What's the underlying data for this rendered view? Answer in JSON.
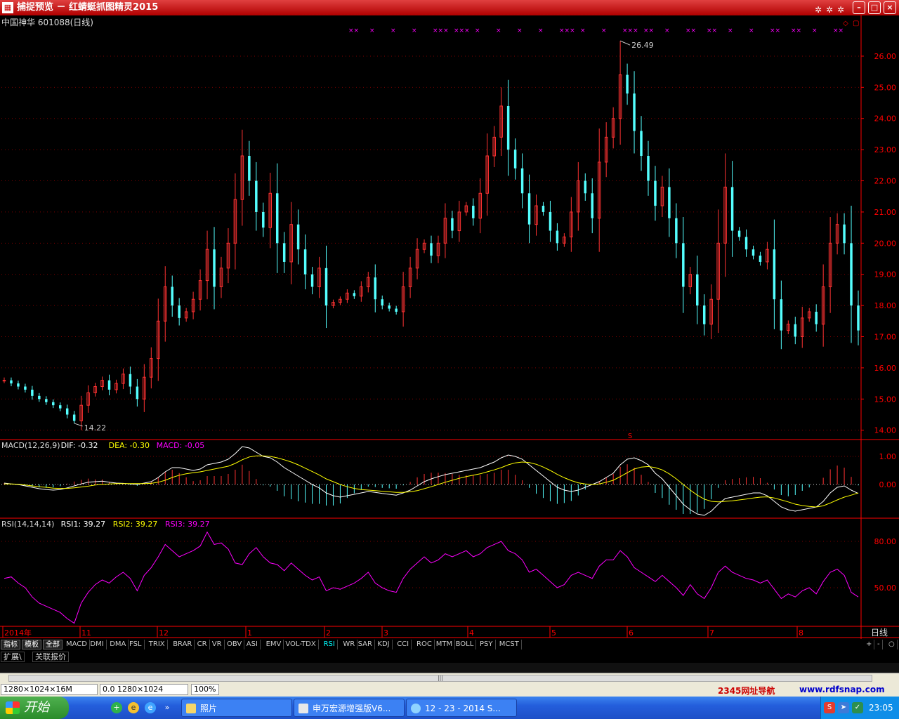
{
  "window": {
    "app_icon": "stock-app-icon",
    "title": "捕捉预览 － 红蜻蜓抓图精灵2015",
    "buttons": {
      "minimize": "–",
      "maximize": "□",
      "close": "×"
    },
    "toolbar_icons": [
      "pin-icon",
      "pin-icon",
      "pin-icon"
    ]
  },
  "chart_header": {
    "stock_name": "中国神华 601088(日线)"
  },
  "chart_data": [
    {
      "type": "candlestick",
      "title": "中国神华 601088(日线)",
      "ylim": [
        13.7,
        26.9
      ],
      "y_ticks": [
        "26.00",
        "25.00",
        "24.00",
        "23.00",
        "22.00",
        "21.00",
        "20.00",
        "19.00",
        "18.00",
        "17.00",
        "16.00",
        "15.00",
        "14.00"
      ],
      "high_annotation": "26.49",
      "low_annotation": "14.22",
      "x_ticks": [
        "2014年",
        "11",
        "12",
        "1",
        "2",
        "3",
        "4",
        "5",
        "6",
        "7",
        "8"
      ],
      "corner_label": "日线",
      "marker_label": "S",
      "close_path": [
        15.6,
        15.5,
        15.4,
        15.3,
        15.1,
        15.0,
        14.9,
        14.8,
        14.7,
        14.5,
        14.3,
        14.8,
        15.2,
        15.4,
        15.6,
        15.3,
        15.5,
        15.8,
        15.4,
        15.0,
        15.7,
        16.3,
        17.5,
        18.6,
        18.0,
        17.6,
        17.8,
        18.2,
        18.8,
        19.8,
        18.6,
        19.2,
        20.0,
        21.4,
        22.8,
        22.0,
        21.0,
        20.5,
        21.6,
        20.0,
        19.4,
        20.6,
        19.8,
        19.0,
        18.6,
        19.2,
        18.0,
        18.1,
        18.2,
        18.4,
        18.3,
        18.6,
        18.9,
        18.2,
        18.0,
        17.9,
        17.8,
        18.6,
        19.2,
        19.8,
        20.0,
        19.6,
        20.0,
        20.8,
        20.4,
        21.0,
        21.2,
        20.8,
        21.6,
        22.8,
        23.4,
        24.4,
        23.0,
        22.4,
        21.6,
        20.6,
        21.2,
        21.0,
        20.4,
        20.0,
        20.2,
        21.0,
        22.0,
        21.6,
        20.8,
        22.6,
        23.4,
        24.0,
        25.4,
        24.8,
        23.6,
        22.8,
        22.0,
        21.2,
        21.8,
        20.8,
        20.0,
        18.6,
        19.0,
        18.0,
        17.4,
        18.2,
        20.0,
        21.8,
        20.4,
        20.2,
        19.8,
        19.6,
        19.4,
        19.8,
        18.2,
        17.2,
        17.4,
        17.0,
        17.6,
        17.8,
        17.4,
        18.6,
        20.0,
        20.6,
        20.0,
        18.0,
        17.2
      ],
      "signal_marks": [
        "××",
        "×",
        "×",
        "×",
        "×××",
        "×××",
        "×",
        "×",
        "×",
        "×",
        "×××",
        "×",
        "×",
        "×××",
        "××",
        "×",
        "××",
        "××",
        "×",
        "×",
        "××",
        "××",
        "×",
        "××"
      ]
    },
    {
      "type": "line",
      "title": "MACD(12,26,9)",
      "legend": [
        {
          "label": "DIF: -0.32",
          "color": "#ffffff"
        },
        {
          "label": "DEA: -0.30",
          "color": "#ffff00"
        },
        {
          "label": "MACD: -0.05",
          "color": "#ff00ff"
        }
      ],
      "ylim": [
        -1.2,
        1.6
      ],
      "y_ticks": [
        "1.00",
        "0.00"
      ],
      "dif_path": [
        0.05,
        0.02,
        0.0,
        -0.05,
        -0.1,
        -0.15,
        -0.18,
        -0.2,
        -0.18,
        -0.12,
        -0.05,
        0.02,
        0.08,
        0.1,
        0.12,
        0.08,
        0.05,
        0.04,
        0.02,
        0.0,
        0.05,
        0.1,
        0.25,
        0.45,
        0.6,
        0.6,
        0.55,
        0.5,
        0.55,
        0.7,
        0.75,
        0.8,
        0.9,
        1.1,
        1.35,
        1.3,
        1.15,
        1.0,
        0.95,
        0.8,
        0.6,
        0.45,
        0.3,
        0.15,
        0.0,
        -0.12,
        -0.3,
        -0.4,
        -0.45,
        -0.4,
        -0.35,
        -0.3,
        -0.25,
        -0.28,
        -0.32,
        -0.35,
        -0.38,
        -0.3,
        -0.2,
        -0.05,
        0.1,
        0.2,
        0.28,
        0.35,
        0.4,
        0.45,
        0.5,
        0.55,
        0.6,
        0.7,
        0.8,
        0.95,
        1.05,
        1.0,
        0.9,
        0.7,
        0.5,
        0.3,
        0.1,
        -0.1,
        -0.2,
        -0.25,
        -0.2,
        -0.1,
        0.0,
        0.1,
        0.25,
        0.4,
        0.7,
        0.9,
        0.95,
        0.85,
        0.7,
        0.4,
        0.2,
        -0.1,
        -0.4,
        -0.7,
        -0.9,
        -1.05,
        -1.1,
        -0.95,
        -0.7,
        -0.5,
        -0.45,
        -0.4,
        -0.35,
        -0.3,
        -0.3,
        -0.4,
        -0.6,
        -0.8,
        -0.9,
        -0.95,
        -0.9,
        -0.85,
        -0.8,
        -0.6,
        -0.3,
        -0.1,
        -0.05,
        -0.2,
        -0.32
      ],
      "dea_path": [
        0.02,
        0.02,
        0.01,
        -0.02,
        -0.05,
        -0.08,
        -0.1,
        -0.13,
        -0.14,
        -0.14,
        -0.12,
        -0.09,
        -0.06,
        -0.02,
        0.0,
        0.02,
        0.03,
        0.03,
        0.03,
        0.03,
        0.03,
        0.04,
        0.08,
        0.15,
        0.25,
        0.33,
        0.38,
        0.42,
        0.45,
        0.5,
        0.55,
        0.6,
        0.65,
        0.75,
        0.88,
        0.98,
        1.02,
        1.02,
        1.0,
        0.95,
        0.88,
        0.8,
        0.7,
        0.58,
        0.46,
        0.34,
        0.2,
        0.1,
        0.0,
        -0.08,
        -0.14,
        -0.18,
        -0.2,
        -0.22,
        -0.24,
        -0.26,
        -0.28,
        -0.28,
        -0.26,
        -0.22,
        -0.15,
        -0.08,
        0.0,
        0.08,
        0.15,
        0.22,
        0.28,
        0.33,
        0.38,
        0.45,
        0.52,
        0.6,
        0.7,
        0.77,
        0.8,
        0.78,
        0.72,
        0.62,
        0.5,
        0.36,
        0.24,
        0.14,
        0.06,
        0.02,
        0.0,
        0.02,
        0.08,
        0.15,
        0.28,
        0.42,
        0.55,
        0.62,
        0.64,
        0.6,
        0.52,
        0.38,
        0.2,
        0.0,
        -0.2,
        -0.38,
        -0.52,
        -0.6,
        -0.62,
        -0.6,
        -0.58,
        -0.55,
        -0.52,
        -0.48,
        -0.45,
        -0.44,
        -0.48,
        -0.55,
        -0.62,
        -0.7,
        -0.75,
        -0.78,
        -0.8,
        -0.76,
        -0.66,
        -0.55,
        -0.45,
        -0.38,
        -0.3
      ]
    },
    {
      "type": "line",
      "title": "RSI(14,14,14)",
      "legend": [
        {
          "label": "RSI1: 39.27",
          "color": "#ffffff"
        },
        {
          "label": "RSI2: 39.27",
          "color": "#ffff00"
        },
        {
          "label": "RSI3: 39.27",
          "color": "#ff00ff"
        }
      ],
      "ylim": [
        25,
        95
      ],
      "y_ticks": [
        "80.00",
        "50.00"
      ],
      "rsi_path": [
        56,
        57,
        53,
        50,
        44,
        40,
        38,
        36,
        34,
        30,
        27,
        40,
        47,
        52,
        55,
        53,
        57,
        60,
        56,
        48,
        58,
        63,
        70,
        78,
        74,
        70,
        72,
        74,
        77,
        86,
        78,
        79,
        75,
        66,
        65,
        72,
        76,
        70,
        66,
        65,
        61,
        66,
        62,
        58,
        55,
        57,
        48,
        50,
        49,
        51,
        53,
        56,
        60,
        53,
        50,
        48,
        47,
        56,
        62,
        66,
        70,
        66,
        68,
        72,
        70,
        72,
        74,
        70,
        72,
        76,
        78,
        80,
        74,
        72,
        68,
        60,
        62,
        58,
        54,
        50,
        52,
        58,
        60,
        58,
        56,
        64,
        68,
        68,
        74,
        70,
        63,
        60,
        57,
        54,
        58,
        54,
        50,
        45,
        52,
        46,
        43,
        50,
        60,
        64,
        60,
        58,
        56,
        55,
        53,
        55,
        49,
        43,
        46,
        44,
        48,
        50,
        46,
        54,
        60,
        62,
        58,
        47,
        44
      ]
    }
  ],
  "indicator_tabs": {
    "items": [
      "指标",
      "模板",
      "全部",
      "MACD",
      "DMI",
      "DMA",
      "FSL",
      "TRIX",
      "BRAR",
      "CR",
      "VR",
      "OBV",
      "ASI",
      "EMV",
      "VOL-TDX",
      "RSI",
      "WR",
      "SAR",
      "KDJ",
      "CCI",
      "ROC",
      "MTM",
      "BOLL",
      "PSY",
      "MCST"
    ],
    "active": "RSI",
    "right_buttons": [
      "+",
      "-",
      "○"
    ]
  },
  "sub_tabs": [
    "扩展\\",
    "关联报价"
  ],
  "status": {
    "dims": "1280×1024×16M",
    "pos": "0.0 1280×1024",
    "zoom": "100%",
    "nav_text": "2345网址导航",
    "url": "www.rdfsnap.com"
  },
  "taskbar": {
    "start_label": "开始",
    "tasks": [
      "照片",
      "申万宏源增强版V6...",
      "12 - 23 - 2014 S..."
    ],
    "clock": "23:05"
  },
  "colors": {
    "up": "#ff3232",
    "down": "#54ffff",
    "grid": "#800000",
    "axis": "#ff0000",
    "rsi": "#ff00ff"
  }
}
